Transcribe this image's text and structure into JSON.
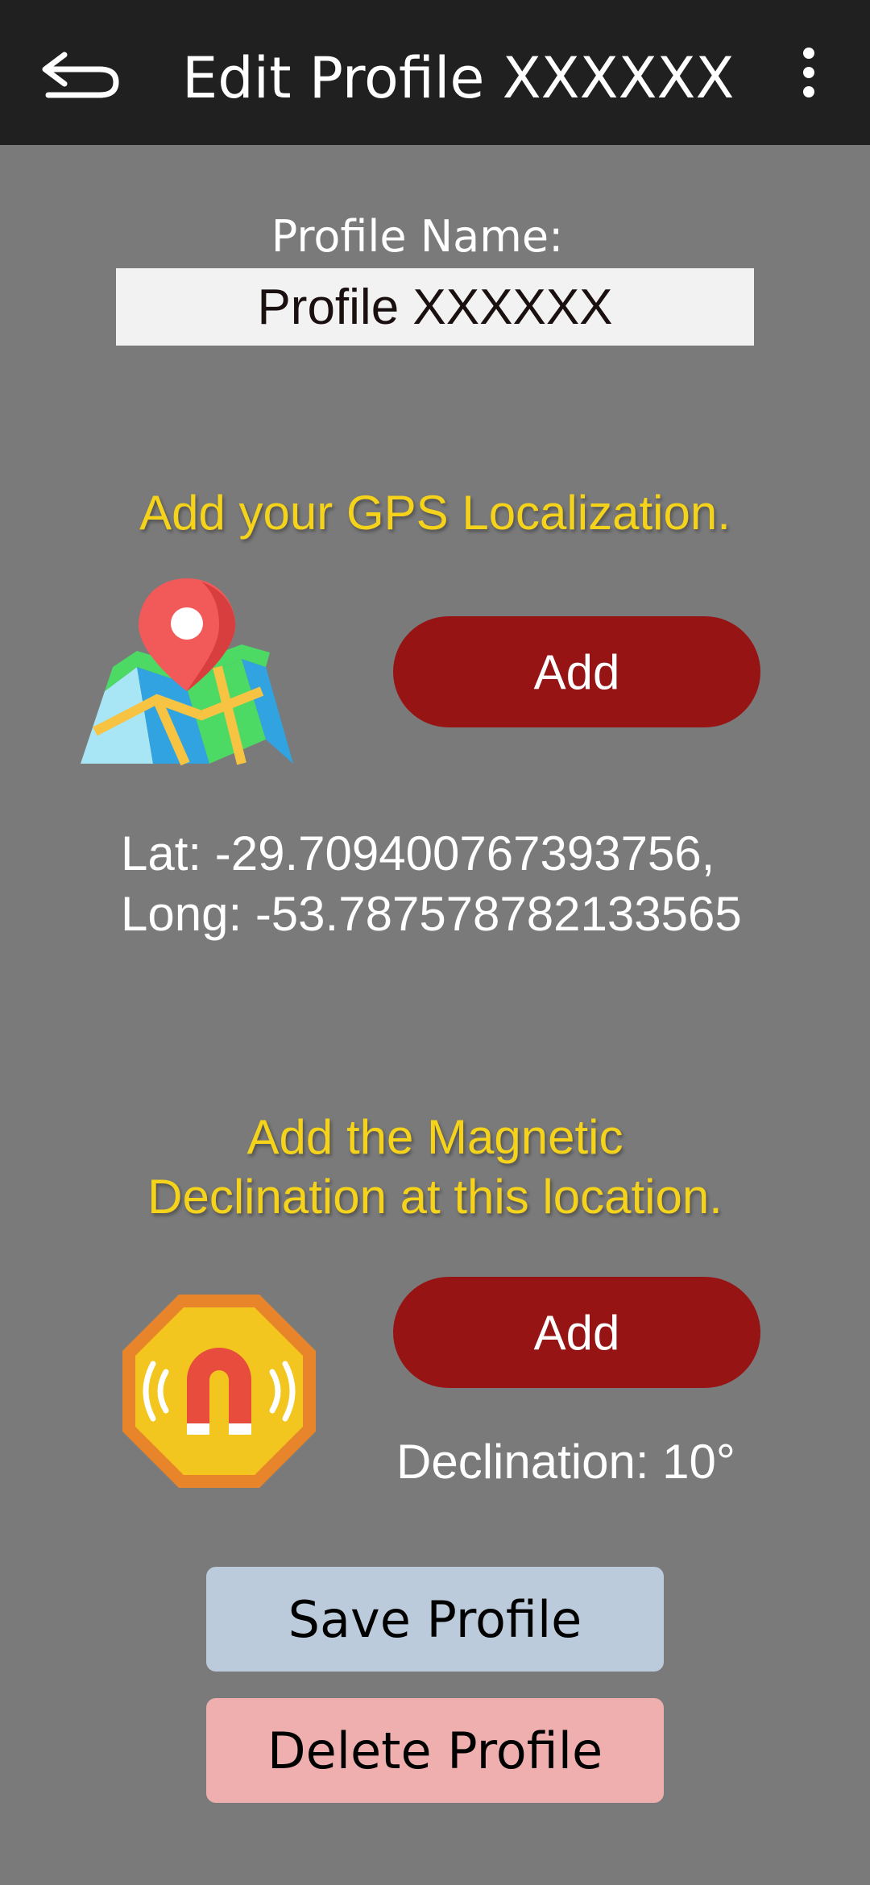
{
  "app_bar": {
    "title": "Edit Profile XXXXXX",
    "back_icon": "back-arrow-icon",
    "menu_icon": "more-vert-icon"
  },
  "profile": {
    "label": "Profile Name:",
    "name_value": "Profile XXXXXX"
  },
  "gps": {
    "heading": "Add your GPS Localization.",
    "icon": "map-pin-icon",
    "add_label": "Add",
    "lat_text": "Lat: -29.709400767393756,",
    "long_text": "Long: -53.787578782133565"
  },
  "magnetic": {
    "heading_line1": "Add the Magnetic",
    "heading_line2": "Declination at this location.",
    "icon": "magnet-icon",
    "add_label": "Add",
    "declination_text": "Declination: 10°"
  },
  "actions": {
    "save_label": "Save Profile",
    "delete_label": "Delete Profile"
  },
  "colors": {
    "background": "#7a7a7a",
    "app_bar": "#202020",
    "heading": "#f5d31a",
    "add_button": "#961414",
    "save_button": "#bccbdb",
    "delete_button": "#efafaf"
  }
}
